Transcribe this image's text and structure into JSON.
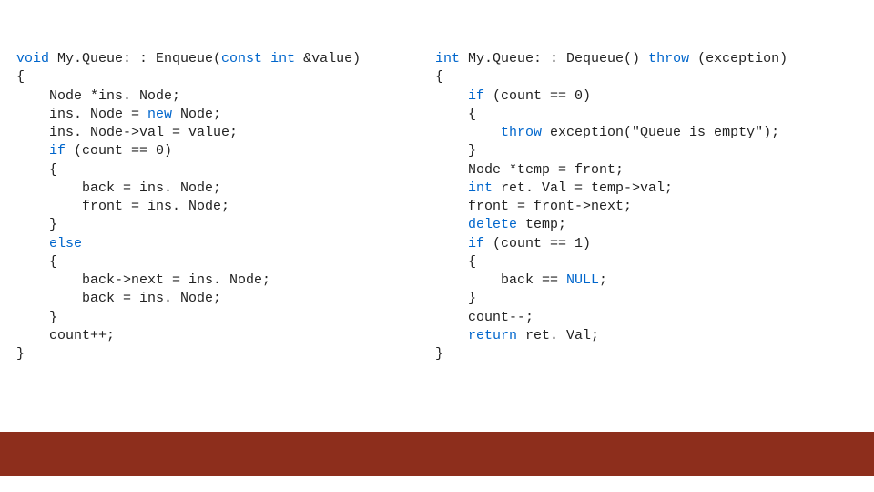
{
  "code_left": {
    "tokens": [
      {
        "t": "void",
        "kw": true
      },
      {
        "t": " My.Queue: : Enqueue("
      },
      {
        "t": "const",
        "kw": true
      },
      {
        "t": " "
      },
      {
        "t": "int",
        "kw": true
      },
      {
        "t": " &value)\n"
      },
      {
        "t": "{\n"
      },
      {
        "t": "    Node *ins. Node;\n"
      },
      {
        "t": "    ins. Node = "
      },
      {
        "t": "new",
        "kw": true
      },
      {
        "t": " Node;\n"
      },
      {
        "t": "    ins. Node->val = value;\n"
      },
      {
        "t": "    "
      },
      {
        "t": "if",
        "kw": true
      },
      {
        "t": " (count == 0)\n"
      },
      {
        "t": "    {\n"
      },
      {
        "t": "        back = ins. Node;\n"
      },
      {
        "t": "        front = ins. Node;\n"
      },
      {
        "t": "    }\n"
      },
      {
        "t": "    "
      },
      {
        "t": "else",
        "kw": true
      },
      {
        "t": "\n"
      },
      {
        "t": "    {\n"
      },
      {
        "t": "        back->next = ins. Node;\n"
      },
      {
        "t": "        back = ins. Node;\n"
      },
      {
        "t": "    }\n"
      },
      {
        "t": "    count++;\n"
      },
      {
        "t": "}\n"
      }
    ]
  },
  "code_right": {
    "tokens": [
      {
        "t": "int",
        "kw": true
      },
      {
        "t": " My.Queue: : Dequeue() "
      },
      {
        "t": "throw",
        "kw": true
      },
      {
        "t": " (exception)\n"
      },
      {
        "t": "{\n"
      },
      {
        "t": "    "
      },
      {
        "t": "if",
        "kw": true
      },
      {
        "t": " (count == 0)\n"
      },
      {
        "t": "    {\n"
      },
      {
        "t": "        "
      },
      {
        "t": "throw",
        "kw": true
      },
      {
        "t": " exception(\"Queue is empty\");\n"
      },
      {
        "t": "    }\n"
      },
      {
        "t": "    Node *temp = front;\n"
      },
      {
        "t": "    "
      },
      {
        "t": "int",
        "kw": true
      },
      {
        "t": " ret. Val = temp->val;\n"
      },
      {
        "t": "    front = front->next;\n"
      },
      {
        "t": "    "
      },
      {
        "t": "delete",
        "kw": true
      },
      {
        "t": " temp;\n"
      },
      {
        "t": "    "
      },
      {
        "t": "if",
        "kw": true
      },
      {
        "t": " (count == 1)\n"
      },
      {
        "t": "    {\n"
      },
      {
        "t": "        back == "
      },
      {
        "t": "NULL",
        "kw": true
      },
      {
        "t": ";\n"
      },
      {
        "t": "    }\n"
      },
      {
        "t": "    count--;\n"
      },
      {
        "t": "    "
      },
      {
        "t": "return",
        "kw": true
      },
      {
        "t": " ret. Val;\n"
      },
      {
        "t": "}\n"
      }
    ]
  },
  "colors": {
    "keyword": "#0066cc",
    "footer": "#8d2e1c"
  }
}
